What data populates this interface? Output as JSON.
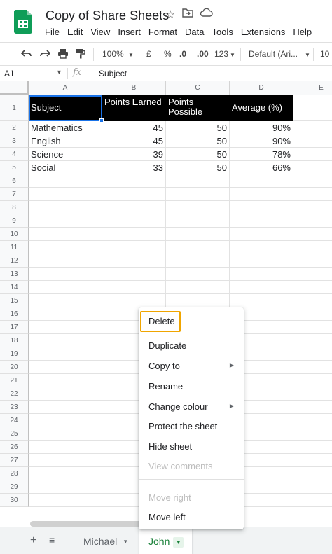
{
  "app": {
    "doc_title": "Copy of Share Sheets",
    "menus": [
      "File",
      "Edit",
      "View",
      "Insert",
      "Format",
      "Data",
      "Tools",
      "Extensions",
      "Help"
    ]
  },
  "toolbar": {
    "zoom": "100%",
    "currency": "£",
    "percent": "%",
    "dec_decrease": ".0",
    "dec_increase": ".00",
    "more_formats": "123",
    "font": "Default (Ari...",
    "font_size": "10"
  },
  "formula_bar": {
    "cell_ref": "A1",
    "fx": "fx",
    "content": "Subject"
  },
  "columns": [
    "A",
    "B",
    "C",
    "D",
    "E"
  ],
  "rows": [
    "1",
    "2",
    "3",
    "4",
    "5",
    "6",
    "7",
    "8",
    "9",
    "10",
    "11",
    "12",
    "13",
    "14",
    "15",
    "16",
    "17",
    "18",
    "19",
    "20",
    "21",
    "22",
    "23",
    "24",
    "25",
    "26",
    "27",
    "28",
    "29",
    "30"
  ],
  "table": {
    "headers": [
      "Subject",
      "Points Earned",
      "Points Possible",
      "Average (%)"
    ],
    "data": [
      [
        "Mathematics",
        "45",
        "50",
        "90%"
      ],
      [
        "English",
        "45",
        "50",
        "90%"
      ],
      [
        "Science",
        "39",
        "50",
        "78%"
      ],
      [
        "Social",
        "33",
        "50",
        "66%"
      ]
    ]
  },
  "context_menu": {
    "items": [
      {
        "label": "Delete",
        "highlighted": true
      },
      {
        "label": "Duplicate"
      },
      {
        "label": "Copy to",
        "submenu": true
      },
      {
        "label": "Rename"
      },
      {
        "label": "Change colour",
        "submenu": true
      },
      {
        "label": "Protect the sheet"
      },
      {
        "label": "Hide sheet"
      },
      {
        "label": "View comments",
        "disabled": true
      },
      {
        "label": "Move right",
        "disabled": true
      },
      {
        "label": "Move left"
      }
    ]
  },
  "sheets": {
    "tabs": [
      {
        "label": "Michael"
      },
      {
        "label": "John",
        "active": true,
        "color": "#188038"
      }
    ]
  },
  "colors": {
    "brand_green": "#0f9d58",
    "selection_blue": "#1a73e8",
    "highlight_orange": "#f0a500"
  }
}
